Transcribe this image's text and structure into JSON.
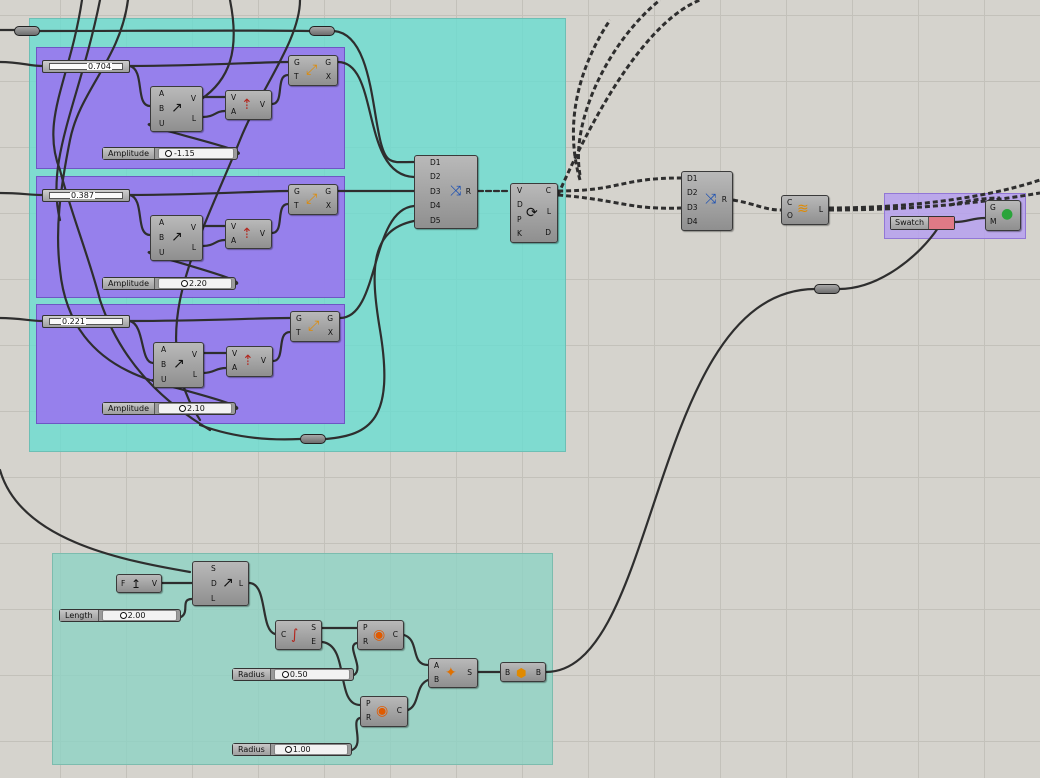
{
  "colors": {
    "canvas": "#d5d3cd",
    "group_teal": "#66ded1",
    "group_purple": "#9878ee",
    "swatch": "#e07a86"
  },
  "sliders": {
    "amp1": {
      "label": "Amplitude",
      "value": "-1.15"
    },
    "amp2": {
      "label": "Amplitude",
      "value": "2.20"
    },
    "amp3": {
      "label": "Amplitude",
      "value": "2.10"
    },
    "length": {
      "label": "Length",
      "value": "2.00"
    },
    "radius1": {
      "label": "Radius",
      "value": "0.50"
    },
    "radius2": {
      "label": "Radius",
      "value": "1.00"
    }
  },
  "numbers": {
    "n1": "0.704",
    "n2": "0.387",
    "n3": "0.221"
  },
  "swatch": {
    "label": "Swatch"
  },
  "components": {
    "vec2pt": {
      "inputs": [
        "A",
        "B",
        "U"
      ],
      "outputs": [
        "V",
        "L"
      ],
      "icon": "vector-2pt-icon"
    },
    "amplitude": {
      "inputs": [
        "V",
        "A"
      ],
      "outputs": [
        "V"
      ],
      "icon": "amplitude-icon"
    },
    "move": {
      "inputs": [
        "G",
        "T"
      ],
      "outputs": [
        "G",
        "X"
      ],
      "icon": "move-icon"
    },
    "merge5": {
      "inputs": [
        "D1",
        "D2",
        "D3",
        "D4",
        "D5"
      ],
      "outputs": [
        "R"
      ],
      "icon": "merge-icon"
    },
    "graph": {
      "inputs": [
        "V",
        "D",
        "P",
        "K"
      ],
      "outputs": [
        "C",
        "L",
        "D"
      ],
      "icon": "graph-mapper-icon"
    },
    "merge4": {
      "inputs": [
        "D1",
        "D2",
        "D3",
        "D4"
      ],
      "outputs": [
        "R"
      ],
      "icon": "merge-icon"
    },
    "pipe": {
      "inputs": [
        "C",
        "O"
      ],
      "outputs": [
        "L"
      ],
      "icon": "curve-pipe-icon"
    },
    "preview": {
      "inputs": [
        "G",
        "M"
      ],
      "outputs": [],
      "icon": "custom-preview-icon"
    },
    "unitz": {
      "inputs": [
        "F"
      ],
      "outputs": [
        "V"
      ],
      "icon": "unit-z-icon"
    },
    "line": {
      "inputs": [
        "S",
        "D",
        "L"
      ],
      "outputs": [
        "L"
      ],
      "icon": "line-sdl-icon"
    },
    "endpts": {
      "inputs": [
        "C"
      ],
      "outputs": [
        "S",
        "E"
      ],
      "icon": "end-points-icon"
    },
    "circle1": {
      "inputs": [
        "P",
        "R"
      ],
      "outputs": [
        "C"
      ],
      "icon": "circle-icon"
    },
    "circle2": {
      "inputs": [
        "P",
        "R"
      ],
      "outputs": [
        "C"
      ],
      "icon": "circle-icon"
    },
    "loft": {
      "inputs": [
        "A",
        "B"
      ],
      "outputs": [
        "S"
      ],
      "icon": "loft-icon"
    },
    "brep": {
      "inputs": [
        "B"
      ],
      "outputs": [
        "B"
      ],
      "icon": "brep-param-icon"
    }
  }
}
